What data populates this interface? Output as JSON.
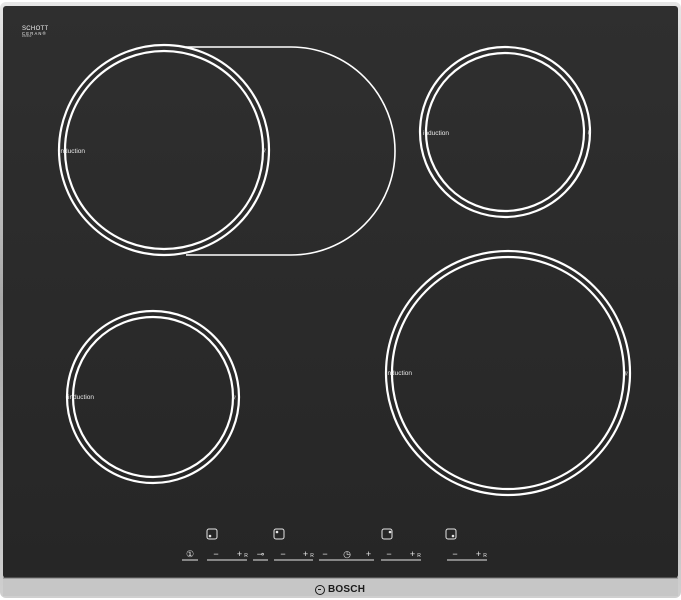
{
  "hob": {
    "brand": "BOSCH",
    "glass_logo": {
      "line1": "SCHOTT",
      "line2": "CERAN®",
      "line3": "######"
    },
    "zones": [
      {
        "label": "induction",
        "symbol": "≈"
      },
      {
        "label": "induction",
        "symbol": "≈"
      },
      {
        "label": "induction",
        "symbol": "≈"
      },
      {
        "label": "induction",
        "symbol": "≈"
      }
    ],
    "controls": {
      "power": "①",
      "minus": "−",
      "plus": "+",
      "boost": "R",
      "lock": "⊸",
      "timer": "◷"
    }
  },
  "colors": {
    "glass": "#2b2b2b",
    "frame": "#b9b9b9",
    "markings": "#ffffff"
  }
}
